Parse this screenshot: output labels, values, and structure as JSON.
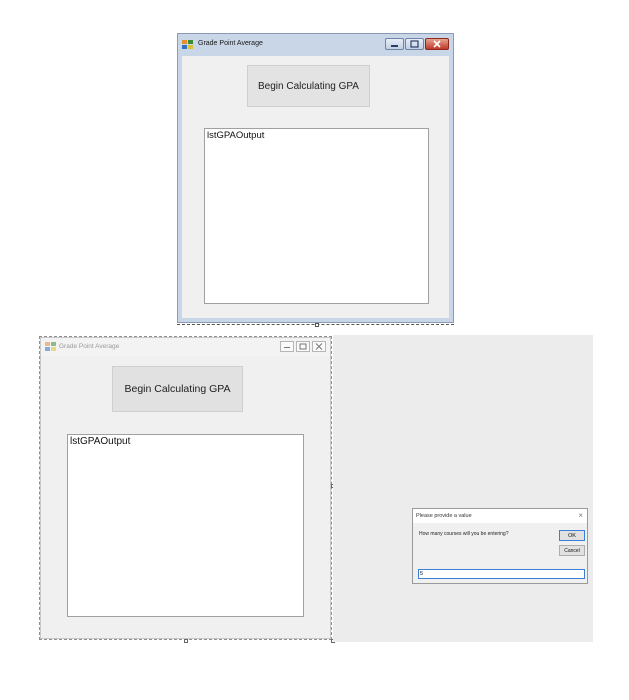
{
  "top_window": {
    "title": "Grade Point Average",
    "button_label": "Begin Calculating GPA",
    "listbox_text": "lstGPAOutput"
  },
  "designer_window": {
    "title": "Grade Point Average",
    "button_label": "Begin Calculating GPA",
    "listbox_text": "lstGPAOutput"
  },
  "dialog": {
    "title": "Please provide a value",
    "close_glyph": "×",
    "prompt": "How many courses will you be entering?",
    "ok_label": "OK",
    "cancel_label": "Cancel",
    "input_value": "5"
  },
  "colors": {
    "accent": "#3c7fd6",
    "close_button": "#c0392b",
    "client_bg": "#f0f0f0"
  },
  "icons": [
    "app-icon",
    "minimize-icon",
    "maximize-icon",
    "close-icon"
  ]
}
